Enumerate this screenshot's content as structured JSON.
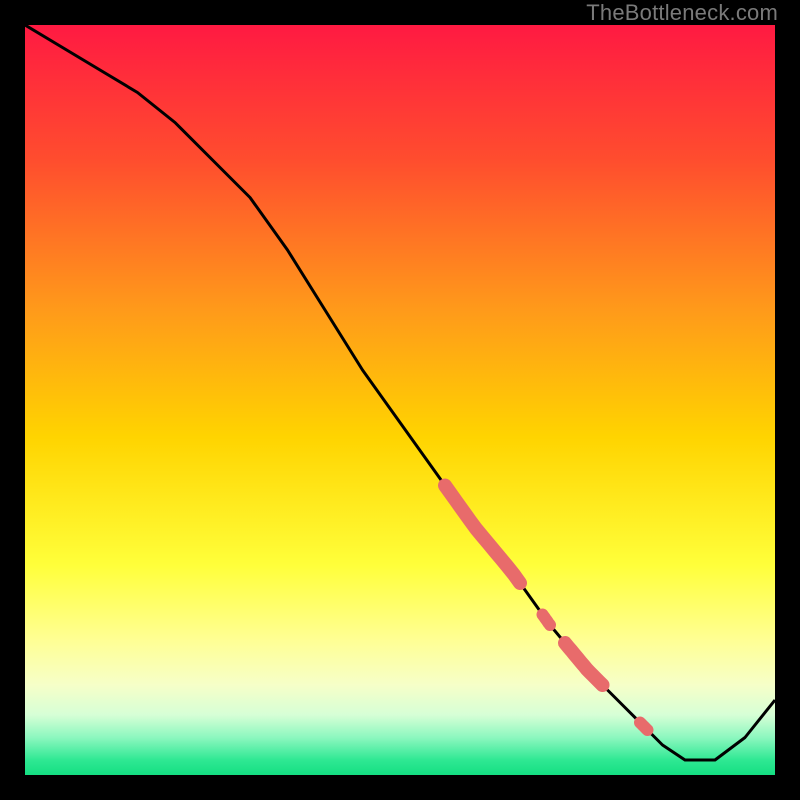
{
  "watermark": "TheBottleneck.com",
  "colors": {
    "frame": "#000000",
    "gradient_top": "#ff1a42",
    "gradient_mid1": "#ff7a1f",
    "gradient_mid2": "#ffd400",
    "gradient_mid3": "#ffff6e",
    "gradient_mid4": "#f3ffb8",
    "gradient_bottom": "#17e884",
    "line": "#000000",
    "marker": "#e86b6b"
  },
  "chart_data": {
    "type": "line",
    "title": "",
    "xlabel": "",
    "ylabel": "",
    "xlim": [
      0,
      100
    ],
    "ylim": [
      0,
      100
    ],
    "series": [
      {
        "name": "curve",
        "x": [
          0,
          5,
          10,
          15,
          20,
          25,
          30,
          35,
          40,
          45,
          50,
          55,
          60,
          65,
          70,
          75,
          80,
          85,
          88,
          92,
          96,
          100
        ],
        "y": [
          100,
          97,
          94,
          91,
          87,
          82,
          77,
          70,
          62,
          54,
          47,
          40,
          33,
          27,
          20,
          14,
          9,
          4,
          2,
          2,
          5,
          10
        ]
      }
    ],
    "markers": [
      {
        "x_range": [
          56,
          66
        ],
        "style": "thick"
      },
      {
        "x_range": [
          69,
          70
        ],
        "style": "dot"
      },
      {
        "x_range": [
          72,
          77
        ],
        "style": "thick"
      },
      {
        "x_range": [
          82,
          83
        ],
        "style": "dot"
      }
    ],
    "grid": false,
    "legend": false
  }
}
